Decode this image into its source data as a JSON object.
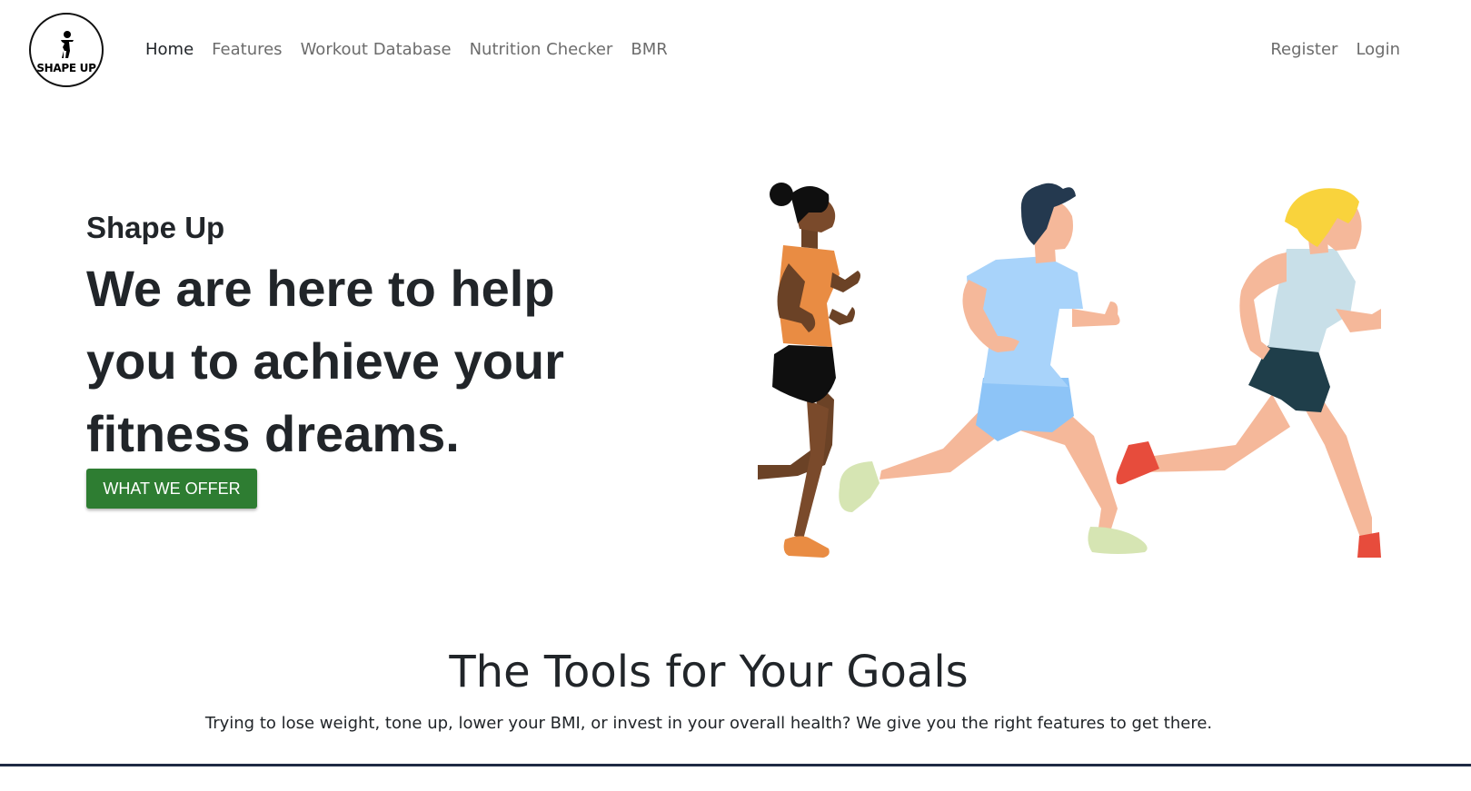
{
  "brand": {
    "logo_text": "SHAPE UP"
  },
  "nav": {
    "links": [
      {
        "label": "Home",
        "active": true
      },
      {
        "label": "Features"
      },
      {
        "label": "Workout Database"
      },
      {
        "label": "Nutrition Checker"
      },
      {
        "label": "BMR"
      }
    ],
    "right": [
      {
        "label": "Register"
      },
      {
        "label": "Login"
      }
    ]
  },
  "hero": {
    "subtitle": "Shape Up",
    "title": "We are here to help you to achieve your fitness dreams.",
    "cta_label": "WHAT WE OFFER",
    "illustration_icon": "runners-illustration"
  },
  "features_section": {
    "title": "The Tools for Your Goals",
    "text": "Trying to lose weight, tone up, lower your BMI, or invest in your overall health? We give you the right features to get there."
  },
  "colors": {
    "cta_background": "#2e7d32",
    "nav_inactive": "#6c6c6c",
    "text": "#212529"
  }
}
